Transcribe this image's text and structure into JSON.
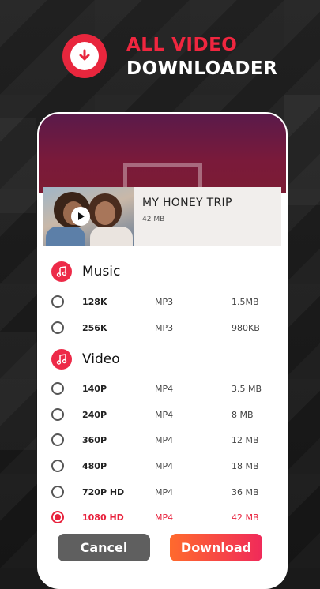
{
  "header": {
    "line1": "ALL VIDEO",
    "line2": "DOWNLOADER",
    "logo_icon": "download-arrow-icon"
  },
  "video": {
    "title": "MY HONEY TRIP",
    "size": "42 MB",
    "play_icon": "play-icon"
  },
  "music": {
    "label": "Music",
    "icon": "music-note-icon",
    "options": [
      {
        "quality": "128K",
        "format": "MP3",
        "size": "1.5MB",
        "selected": false
      },
      {
        "quality": "256K",
        "format": "MP3",
        "size": "980KB",
        "selected": false
      }
    ]
  },
  "videoSection": {
    "label": "Video",
    "icon": "music-note-icon",
    "options": [
      {
        "quality": "140P",
        "format": "MP4",
        "size": "3.5 MB",
        "selected": false
      },
      {
        "quality": "240P",
        "format": "MP4",
        "size": "8 MB",
        "selected": false
      },
      {
        "quality": "360P",
        "format": "MP4",
        "size": "12 MB",
        "selected": false
      },
      {
        "quality": "480P",
        "format": "MP4",
        "size": "18 MB",
        "selected": false
      },
      {
        "quality": "720P HD",
        "format": "MP4",
        "size": "36 MB",
        "selected": false
      },
      {
        "quality": "1080 HD",
        "format": "MP4",
        "size": "42 MB",
        "selected": true
      }
    ]
  },
  "actions": {
    "cancel": "Cancel",
    "download": "Download"
  },
  "colors": {
    "accent": "#e8213c",
    "cancel_bg": "#5f5f5f",
    "download_gradient": [
      "#ff6a2d",
      "#f02a5a"
    ]
  }
}
